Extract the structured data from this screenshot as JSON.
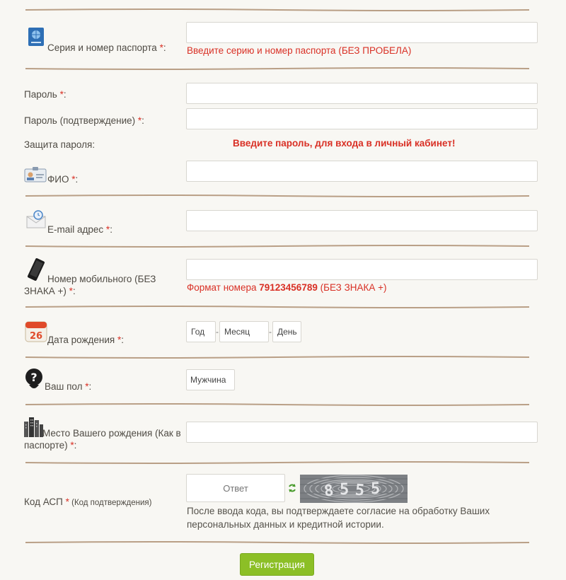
{
  "req_mark": "*",
  "passport": {
    "label": "Серия и номер паспорта",
    "suffix": ":",
    "hint": "Введите серию и номер паспорта (БЕЗ ПРОБЕЛА)",
    "value": ""
  },
  "password": {
    "label": "Пароль",
    "suffix": ":",
    "value": ""
  },
  "password_confirm": {
    "label": "Пароль (подтверждение)",
    "suffix": ":",
    "value": ""
  },
  "password_strength": {
    "label": "Защита пароля:",
    "message": "Введите пароль, для входа в личный кабинет!"
  },
  "fio": {
    "label": "ФИО",
    "suffix": ":",
    "value": ""
  },
  "email": {
    "label": "E-mail адрес",
    "suffix": ":",
    "value": ""
  },
  "phone": {
    "label_line1": "Номер мобильного (БЕЗ",
    "label_line2": "ЗНАКА +)",
    "suffix": ":",
    "hint_prefix": "Формат номера",
    "hint_example": "79123456789",
    "hint_suffix": "(БЕЗ ЗНАКА +)",
    "value": ""
  },
  "birth_date": {
    "label": "Дата рождения",
    "suffix": ":",
    "year": "Год",
    "month": "Месяц",
    "day": "День",
    "sep": "-"
  },
  "gender": {
    "label": "Ваш пол",
    "suffix": ":",
    "value": "Мужчина"
  },
  "birthplace": {
    "label_line1": "Место Вашего рождения (Как в",
    "label_line2": "паспорте)",
    "suffix": ":",
    "value": ""
  },
  "captcha": {
    "label": "Код АСП",
    "sublabel": "(Код подтверждения)",
    "placeholder": "Ответ",
    "refresh_icon": "refresh-icon",
    "note": "После ввода кода, вы подтверждаете согласие на обработку Ваших персональных данных и кредитной истории."
  },
  "submit_label": "Регистрация",
  "colors": {
    "accent_red": "#d93025",
    "button_green": "#8cbf26",
    "background": "#f8f7f3"
  }
}
